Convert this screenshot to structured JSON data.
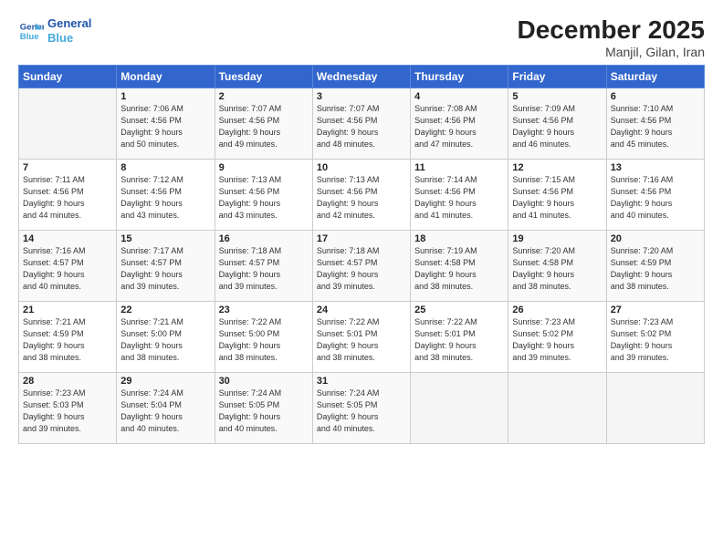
{
  "logo": {
    "line1": "General",
    "line2": "Blue"
  },
  "title": "December 2025",
  "subtitle": "Manjil, Gilan, Iran",
  "header": {
    "days": [
      "Sunday",
      "Monday",
      "Tuesday",
      "Wednesday",
      "Thursday",
      "Friday",
      "Saturday"
    ]
  },
  "weeks": [
    {
      "cells": [
        {
          "day": "",
          "info": ""
        },
        {
          "day": "1",
          "info": "Sunrise: 7:06 AM\nSunset: 4:56 PM\nDaylight: 9 hours\nand 50 minutes."
        },
        {
          "day": "2",
          "info": "Sunrise: 7:07 AM\nSunset: 4:56 PM\nDaylight: 9 hours\nand 49 minutes."
        },
        {
          "day": "3",
          "info": "Sunrise: 7:07 AM\nSunset: 4:56 PM\nDaylight: 9 hours\nand 48 minutes."
        },
        {
          "day": "4",
          "info": "Sunrise: 7:08 AM\nSunset: 4:56 PM\nDaylight: 9 hours\nand 47 minutes."
        },
        {
          "day": "5",
          "info": "Sunrise: 7:09 AM\nSunset: 4:56 PM\nDaylight: 9 hours\nand 46 minutes."
        },
        {
          "day": "6",
          "info": "Sunrise: 7:10 AM\nSunset: 4:56 PM\nDaylight: 9 hours\nand 45 minutes."
        }
      ]
    },
    {
      "cells": [
        {
          "day": "7",
          "info": "Sunrise: 7:11 AM\nSunset: 4:56 PM\nDaylight: 9 hours\nand 44 minutes."
        },
        {
          "day": "8",
          "info": "Sunrise: 7:12 AM\nSunset: 4:56 PM\nDaylight: 9 hours\nand 43 minutes."
        },
        {
          "day": "9",
          "info": "Sunrise: 7:13 AM\nSunset: 4:56 PM\nDaylight: 9 hours\nand 43 minutes."
        },
        {
          "day": "10",
          "info": "Sunrise: 7:13 AM\nSunset: 4:56 PM\nDaylight: 9 hours\nand 42 minutes."
        },
        {
          "day": "11",
          "info": "Sunrise: 7:14 AM\nSunset: 4:56 PM\nDaylight: 9 hours\nand 41 minutes."
        },
        {
          "day": "12",
          "info": "Sunrise: 7:15 AM\nSunset: 4:56 PM\nDaylight: 9 hours\nand 41 minutes."
        },
        {
          "day": "13",
          "info": "Sunrise: 7:16 AM\nSunset: 4:56 PM\nDaylight: 9 hours\nand 40 minutes."
        }
      ]
    },
    {
      "cells": [
        {
          "day": "14",
          "info": "Sunrise: 7:16 AM\nSunset: 4:57 PM\nDaylight: 9 hours\nand 40 minutes."
        },
        {
          "day": "15",
          "info": "Sunrise: 7:17 AM\nSunset: 4:57 PM\nDaylight: 9 hours\nand 39 minutes."
        },
        {
          "day": "16",
          "info": "Sunrise: 7:18 AM\nSunset: 4:57 PM\nDaylight: 9 hours\nand 39 minutes."
        },
        {
          "day": "17",
          "info": "Sunrise: 7:18 AM\nSunset: 4:57 PM\nDaylight: 9 hours\nand 39 minutes."
        },
        {
          "day": "18",
          "info": "Sunrise: 7:19 AM\nSunset: 4:58 PM\nDaylight: 9 hours\nand 38 minutes."
        },
        {
          "day": "19",
          "info": "Sunrise: 7:20 AM\nSunset: 4:58 PM\nDaylight: 9 hours\nand 38 minutes."
        },
        {
          "day": "20",
          "info": "Sunrise: 7:20 AM\nSunset: 4:59 PM\nDaylight: 9 hours\nand 38 minutes."
        }
      ]
    },
    {
      "cells": [
        {
          "day": "21",
          "info": "Sunrise: 7:21 AM\nSunset: 4:59 PM\nDaylight: 9 hours\nand 38 minutes."
        },
        {
          "day": "22",
          "info": "Sunrise: 7:21 AM\nSunset: 5:00 PM\nDaylight: 9 hours\nand 38 minutes."
        },
        {
          "day": "23",
          "info": "Sunrise: 7:22 AM\nSunset: 5:00 PM\nDaylight: 9 hours\nand 38 minutes."
        },
        {
          "day": "24",
          "info": "Sunrise: 7:22 AM\nSunset: 5:01 PM\nDaylight: 9 hours\nand 38 minutes."
        },
        {
          "day": "25",
          "info": "Sunrise: 7:22 AM\nSunset: 5:01 PM\nDaylight: 9 hours\nand 38 minutes."
        },
        {
          "day": "26",
          "info": "Sunrise: 7:23 AM\nSunset: 5:02 PM\nDaylight: 9 hours\nand 39 minutes."
        },
        {
          "day": "27",
          "info": "Sunrise: 7:23 AM\nSunset: 5:02 PM\nDaylight: 9 hours\nand 39 minutes."
        }
      ]
    },
    {
      "cells": [
        {
          "day": "28",
          "info": "Sunrise: 7:23 AM\nSunset: 5:03 PM\nDaylight: 9 hours\nand 39 minutes."
        },
        {
          "day": "29",
          "info": "Sunrise: 7:24 AM\nSunset: 5:04 PM\nDaylight: 9 hours\nand 40 minutes."
        },
        {
          "day": "30",
          "info": "Sunrise: 7:24 AM\nSunset: 5:05 PM\nDaylight: 9 hours\nand 40 minutes."
        },
        {
          "day": "31",
          "info": "Sunrise: 7:24 AM\nSunset: 5:05 PM\nDaylight: 9 hours\nand 40 minutes."
        },
        {
          "day": "",
          "info": ""
        },
        {
          "day": "",
          "info": ""
        },
        {
          "day": "",
          "info": ""
        }
      ]
    }
  ]
}
